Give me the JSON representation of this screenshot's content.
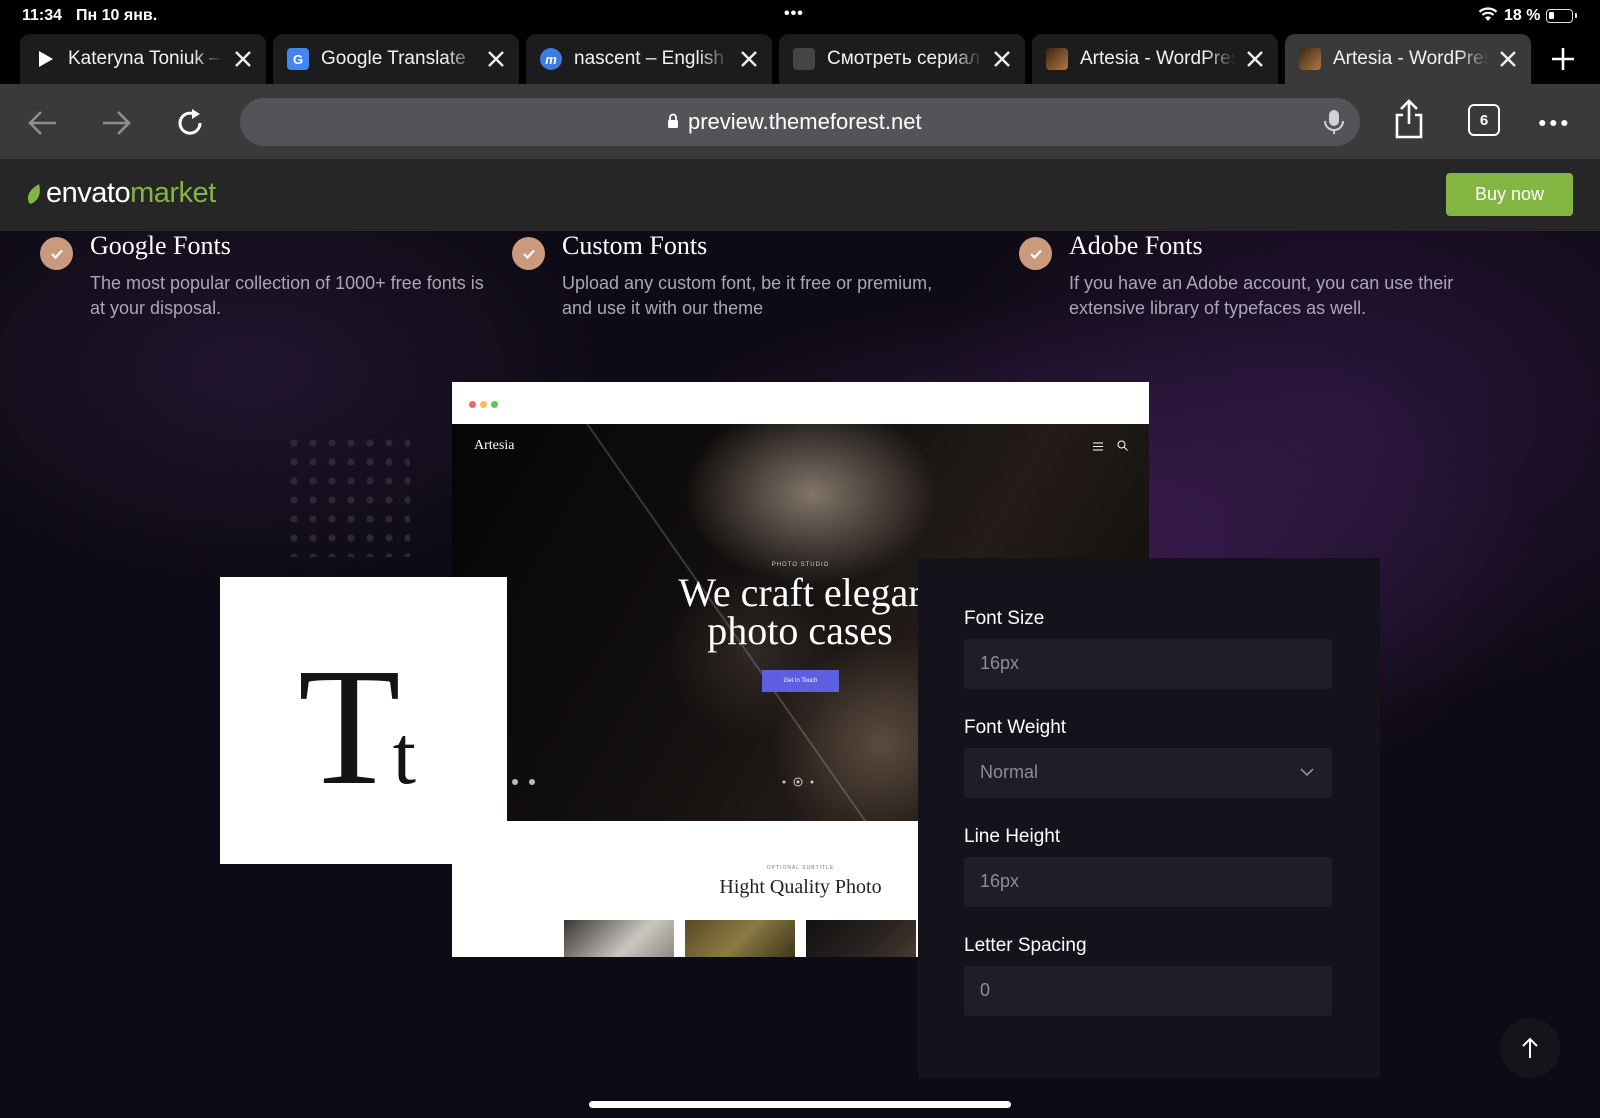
{
  "status_bar": {
    "time": "11:34",
    "date": "Пн 10 янв.",
    "battery": "18 %"
  },
  "tabs": [
    {
      "title": "Kateryna Toniuk – ",
      "favicon": "play-icon",
      "color": "#ffffff"
    },
    {
      "title": "Google Translate",
      "favicon": "google-translate-icon",
      "color": "#4285f4"
    },
    {
      "title": "nascent – English ",
      "favicon": "dictionary-icon",
      "color": "#3c7be0"
    },
    {
      "title": "Смотреть сериал ",
      "favicon": "generic-site-icon",
      "color": "#555555"
    },
    {
      "title": "Artesia - WordPres",
      "favicon": "artesia-icon",
      "color": "#8a5a2e"
    },
    {
      "title": "Artesia - WordPres",
      "favicon": "artesia-icon",
      "color": "#8a5a2e",
      "active": true
    }
  ],
  "toolbar": {
    "url": "preview.themeforest.net",
    "tab_count": "6"
  },
  "envato": {
    "brand": "envato",
    "market": "market",
    "buy_now": "Buy now",
    "accent": "#82b541"
  },
  "features": [
    {
      "title": "Google Fonts",
      "description": "The most popular collection of 1000+ free fonts is at your disposal."
    },
    {
      "title": "Custom Fonts",
      "description": "Upload any custom font, be it free or premium, and use it with our theme"
    },
    {
      "title": "Adobe Fonts",
      "description": "If you have an Adobe account, you can use their extensive library of typefaces as well."
    }
  ],
  "mockup": {
    "site_logo": "Artesia",
    "eyebrow": "PHOTO STUDIO",
    "headline_line1": "We craft elegar",
    "headline_line2": "photo cases",
    "cta": "Get In Touch",
    "subtitle": "OPTIONAL SUBTITLE",
    "section_title": "Hight Quality Photo"
  },
  "tt_card": {
    "big": "T",
    "small": "t"
  },
  "font_panel": {
    "font_size_label": "Font Size",
    "font_size_value": "16px",
    "font_weight_label": "Font Weight",
    "font_weight_value": "Normal",
    "line_height_label": "Line Height",
    "line_height_value": "16px",
    "letter_spacing_label": "Letter Spacing",
    "letter_spacing_value": "0"
  }
}
